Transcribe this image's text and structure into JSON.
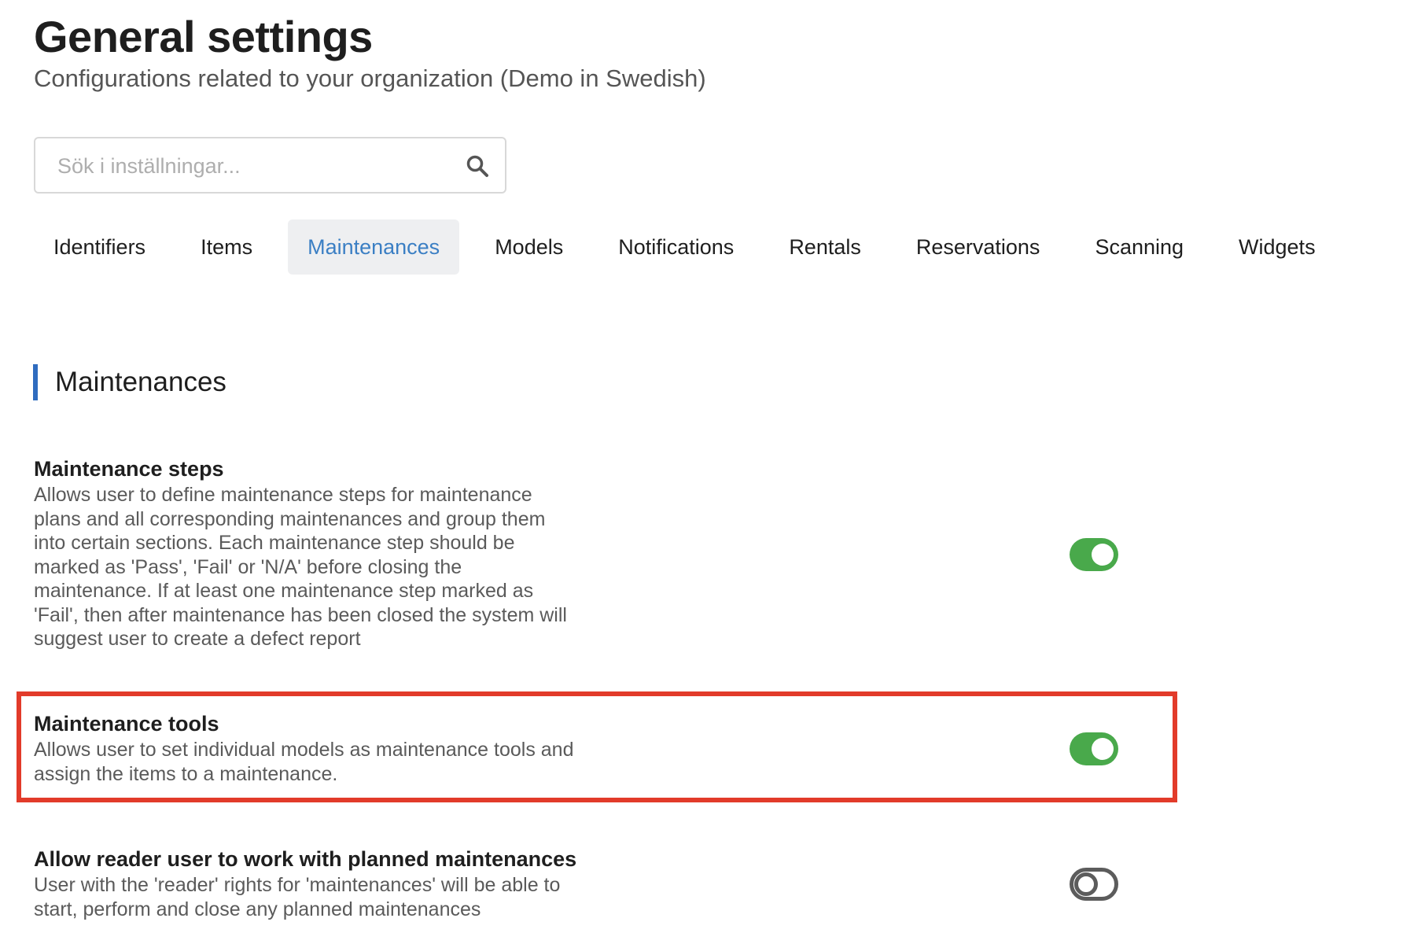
{
  "page": {
    "title": "General settings",
    "subtitle": "Configurations related to your organization (Demo in Swedish)"
  },
  "search": {
    "placeholder": "Sök i inställningar...",
    "value": "",
    "icon": "search-icon"
  },
  "tabs": [
    {
      "label": "Identifiers",
      "active": false
    },
    {
      "label": "Items",
      "active": false
    },
    {
      "label": "Maintenances",
      "active": true
    },
    {
      "label": "Models",
      "active": false
    },
    {
      "label": "Notifications",
      "active": false
    },
    {
      "label": "Rentals",
      "active": false
    },
    {
      "label": "Reservations",
      "active": false
    },
    {
      "label": "Scanning",
      "active": false
    },
    {
      "label": "Widgets",
      "active": false
    }
  ],
  "section": {
    "title": "Maintenances",
    "settings": [
      {
        "title": "Maintenance steps",
        "description": "Allows user to define maintenance steps for maintenance plans and all corresponding maintenances and group them into certain sections. Each maintenance step should be marked as 'Pass', 'Fail' or 'N/A' before closing the maintenance. If at least one maintenance step marked as 'Fail', then after maintenance has been closed the system will suggest user to create a defect report",
        "enabled": true
      },
      {
        "title": "Maintenance tools",
        "description": "Allows user to set individual models as maintenance tools and assign the items to a maintenance.",
        "enabled": true,
        "highlighted": true
      },
      {
        "title": "Allow reader user to work with planned maintenances",
        "description": "User with the 'reader' rights for 'maintenances' will be able to start, perform and close any planned maintenances",
        "enabled": false
      }
    ]
  },
  "colors": {
    "accent": "#3b7fc4",
    "section_bar": "#2f6cbf",
    "toggle_on": "#49a94b",
    "toggle_off": "#5c5c5c",
    "highlight": "#e23b2a",
    "active_tab_bg": "#eeeff1"
  }
}
